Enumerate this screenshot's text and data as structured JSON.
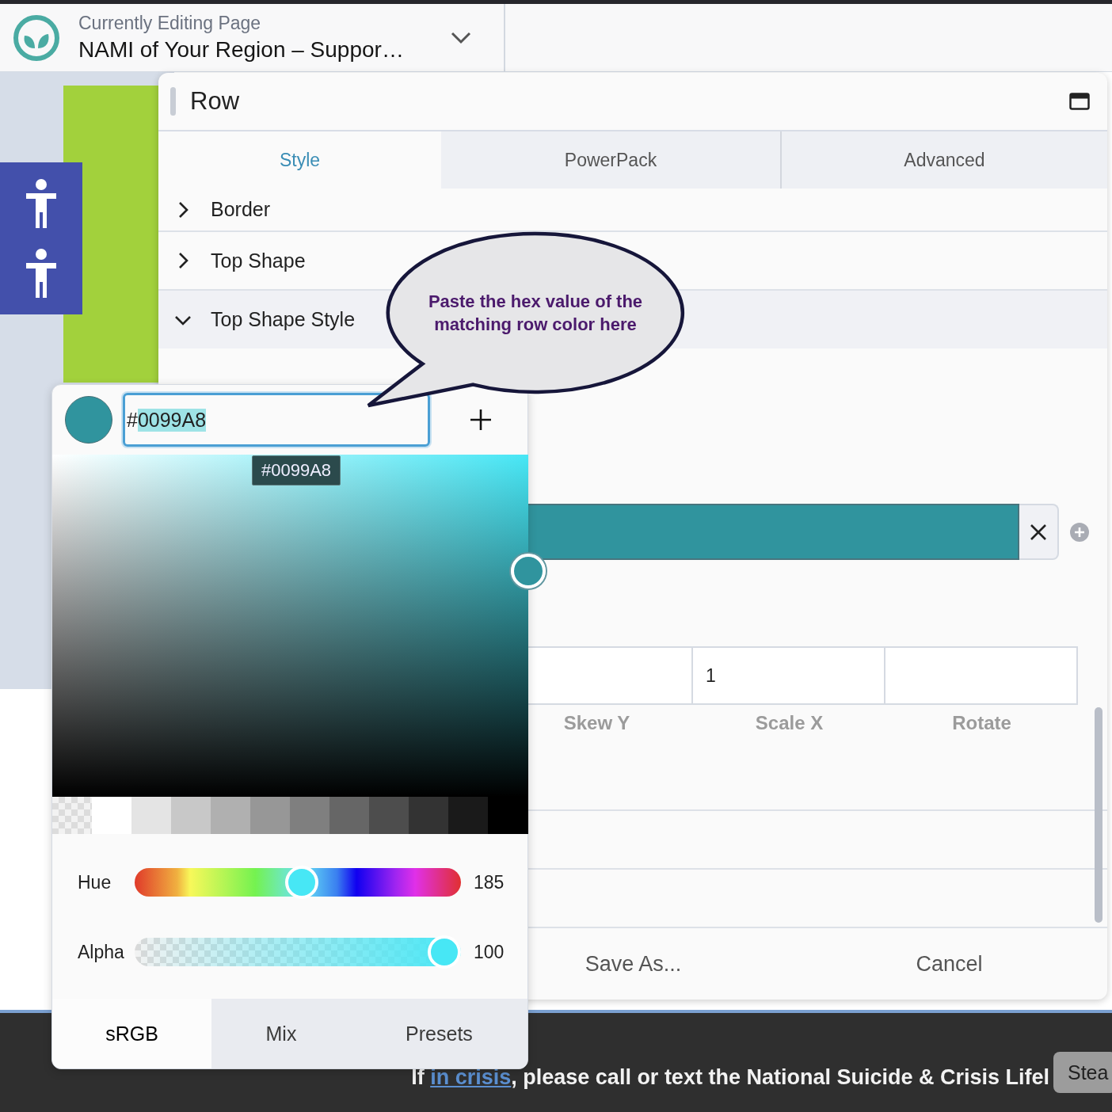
{
  "header": {
    "label": "Currently Editing Page",
    "page_title": "NAMI of Your Region – Suppor…"
  },
  "dialog": {
    "title": "Row",
    "tabs": [
      {
        "label": "Style",
        "selected": true
      },
      {
        "label": "PowerPack",
        "selected": false
      },
      {
        "label": "Advanced",
        "selected": false
      }
    ],
    "sections": [
      {
        "label": "Border",
        "expanded": false
      },
      {
        "label": "Top Shape",
        "expanded": false
      },
      {
        "label": "Top Shape Style",
        "expanded": true
      }
    ],
    "transform_fields": [
      {
        "label": "Skew Y"
      },
      {
        "label": "Scale X",
        "value": "1"
      },
      {
        "label": "Rotate"
      }
    ],
    "buttons": [
      "Save As...",
      "Cancel"
    ]
  },
  "color_picker": {
    "value_parts": [
      {
        "text": "#",
        "selected": false
      },
      {
        "text": "0099A8",
        "selected": true
      }
    ],
    "tooltip": "#0099A8",
    "swatches": [
      {
        "kind": "transparent"
      },
      {
        "kind": "color",
        "color": "#ffffff"
      },
      {
        "kind": "color",
        "color": "#e4e4e4"
      },
      {
        "kind": "color",
        "color": "#c8c8c8"
      },
      {
        "kind": "color",
        "color": "#b0b0b0"
      },
      {
        "kind": "color",
        "color": "#979797"
      },
      {
        "kind": "color",
        "color": "#7f7f7f"
      },
      {
        "kind": "color",
        "color": "#666666"
      },
      {
        "kind": "color",
        "color": "#4d4d4d"
      },
      {
        "kind": "color",
        "color": "#333333"
      },
      {
        "kind": "color",
        "color": "#1a1a1a"
      }
    ],
    "sliders": [
      {
        "label": "Hue",
        "kind": "hue",
        "level": 0.514,
        "reading": "185"
      },
      {
        "label": "Alpha",
        "kind": "alpha",
        "level": 1,
        "reading": "100"
      }
    ],
    "tabs": [
      {
        "label": "sRGB",
        "selected": true
      },
      {
        "label": "Mix",
        "selected": false
      },
      {
        "label": "Presets",
        "selected": false
      }
    ]
  },
  "callout": {
    "text": "Paste the hex value of the matching row color here"
  },
  "footer_bar": {
    "parts": [
      {
        "kind": "text",
        "text": "If "
      },
      {
        "kind": "link",
        "text": "in crisis"
      },
      {
        "kind": "text",
        "text": ", please call or text the National Suicide & Crisis Lifel"
      }
    ],
    "button": "Stea"
  }
}
